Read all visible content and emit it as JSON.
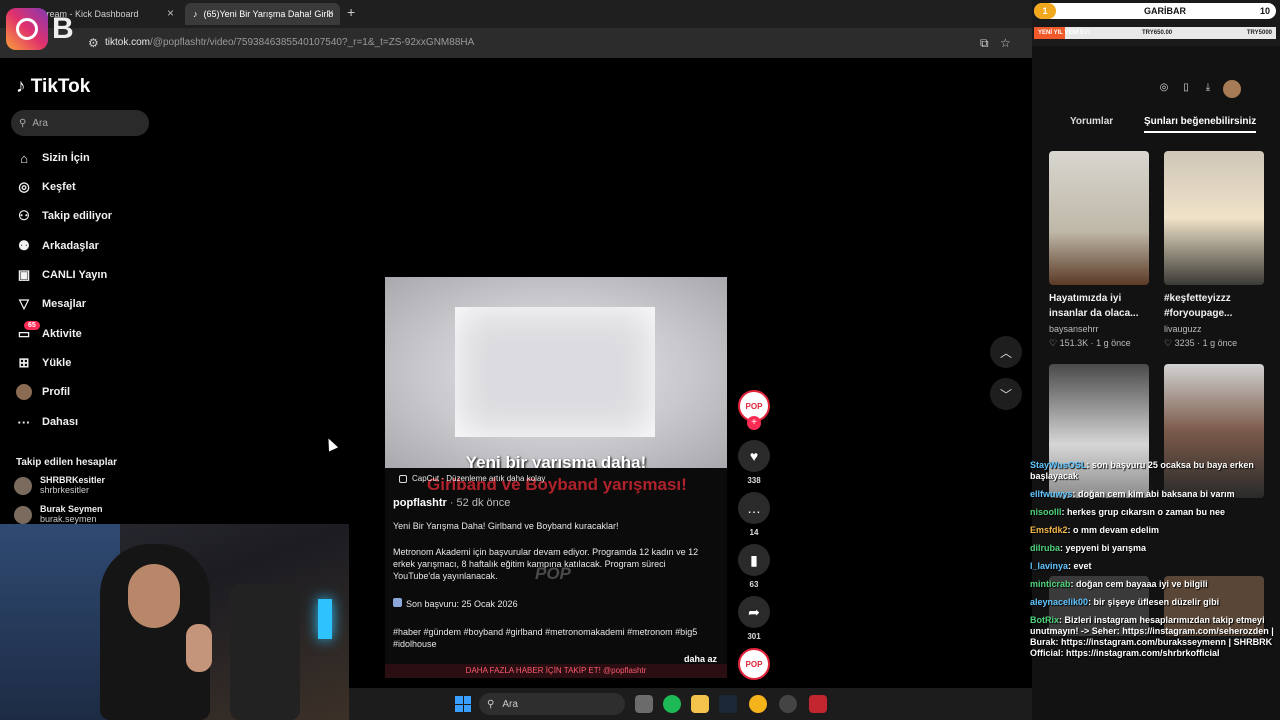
{
  "browser": {
    "tabs": [
      {
        "label": "Stream - Kick Dashboard"
      },
      {
        "label": "(65)Yeni Bir Yarışma Daha! Girlb"
      }
    ],
    "url_main": "tiktok.com",
    "url_path": "/@popflashtr/video/7593846385540107540?_r=1&_t=ZS-92xxGNM88HA"
  },
  "tiktok": {
    "logo": "TikTok",
    "search_placeholder": "Ara",
    "nav": [
      {
        "label": "Sizin İçin",
        "icon": "home-icon"
      },
      {
        "label": "Keşfet",
        "icon": "compass-icon"
      },
      {
        "label": "Takip ediliyor",
        "icon": "person-icon"
      },
      {
        "label": "Arkadaşlar",
        "icon": "friends-icon"
      },
      {
        "label": "CANLI Yayın",
        "icon": "live-icon"
      },
      {
        "label": "Mesajlar",
        "icon": "send-icon"
      },
      {
        "label": "Aktivite",
        "icon": "inbox-icon",
        "badge": "65"
      },
      {
        "label": "Yükle",
        "icon": "upload-icon"
      },
      {
        "label": "Profil",
        "icon": "profile-avatar"
      },
      {
        "label": "Dahası",
        "icon": "more-icon"
      }
    ],
    "followed_title": "Takip edilen hesaplar",
    "followed": [
      {
        "name": "SHRBRKesitler",
        "handle": "shrbrkesitler"
      },
      {
        "name": "Burak Seymen",
        "handle": "burak.seymen"
      }
    ]
  },
  "video": {
    "caption_overlay": "Yeni bir yarışma daha!",
    "red_overlay": "Girlband ve Boyband yarışması!",
    "capcut": "CapCut · Düzenleme artık daha kolay",
    "author": "popflashtr",
    "time": " · 52 dk önce",
    "desc1": "Yeni Bir Yarışma Daha! Girlband ve Boyband kuracaklar!",
    "desc2": "Metronom Akademi için başvurular devam ediyor. Programda 12 kadın ve 12 erkek yarışmacı, 8 haftalık eğitim kampına katılacak. Program süreci YouTube'da yayınlanacak.",
    "desc3": "Son başvuru: 25 Ocak 2026",
    "hashtags": "#haber #gündem #boyband #girlband #metronomakademi #metronom #big5 #idolhouse",
    "more": "daha az",
    "watermark": "POP",
    "bottom_banner": "DAHA FAZLA HABER İÇİN TAKİP ET! @popflashtr"
  },
  "actions": {
    "likes": "338",
    "comments": "14",
    "saves": "63",
    "shares": "301",
    "creator_avatar": "POP"
  },
  "overlay": {
    "garibar_level": "1",
    "garibar_label": "GARİBAR",
    "garibar_target": "10",
    "goal_left": "YENİ YIL YENİ EV!",
    "goal_mid": "TRY650.00",
    "goal_right": "TRY5000",
    "goal_fraction": 0.13
  },
  "right_panel": {
    "tab_comments": "Yorumlar",
    "tab_recommend": "Şunları beğenebilirsiniz",
    "cards": [
      {
        "title": "Hayatımızda iyi insanlar da olaca...",
        "author": "baysansehrr",
        "likes": "151.3K",
        "time": "1 g önce"
      },
      {
        "title": "#keşfetteyizzz #foryoupage...",
        "author": "livauguzz",
        "likes": "3235",
        "time": "1 g önce"
      }
    ]
  },
  "chat": [
    {
      "user": "StayWusOSL",
      "msg": ": son başvuru 25 ocaksa bu baya erken başlayacak",
      "color": "u1"
    },
    {
      "user": "ellfwuwys",
      "msg": ": doğan cem kim abi baksana bi varım",
      "color": "u1"
    },
    {
      "user": "nisoolll",
      "msg": ": herkes grup cıkarsın o zaman bu nee",
      "color": "u2"
    },
    {
      "user": "Emsfdk2",
      "msg": ": o mm devam edelim",
      "color": "u3"
    },
    {
      "user": "dilruba",
      "msg": ": yepyeni bi yarışma",
      "color": "u2"
    },
    {
      "user": "l_lavinya",
      "msg": ": evet",
      "color": "u1"
    },
    {
      "user": "minticrab",
      "msg": ": doğan cem bayaaa iyi ve bilgili",
      "color": "u2"
    },
    {
      "user": "aleynacelik00",
      "msg": ": bir şişeye üflesen düzelir gibi",
      "color": "u1"
    },
    {
      "user": "BotRix",
      "msg": ": Bizleri instagram hesaplarımızdan takip etmeyi unutmayın! -> Seher: https://instagram.com/seherozden | Burak: https://instagram.com/buraksseymenn | SHRBRK Official: https://instagram.com/shrbrkofficial",
      "color": "u2"
    }
  ],
  "taskbar": {
    "search": "Ara"
  }
}
